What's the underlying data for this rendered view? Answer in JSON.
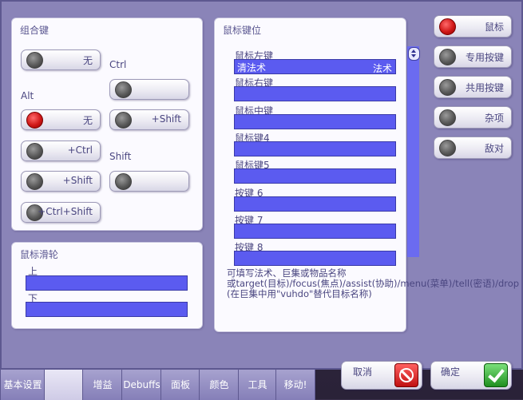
{
  "modifiers": {
    "title": "组合键",
    "ctrl_label": "Ctrl",
    "alt_label": "Alt",
    "shift_label": "Shift",
    "btn_none_top": "无",
    "btn_ctrl_blank": "",
    "btn_alt_none": "无",
    "btn_alt_shift": "+Shift",
    "btn_plus_ctrl": "+Ctrl",
    "btn_plus_shift": "+Shift",
    "btn_shift_blank": "",
    "btn_ctrl_shift": "+Ctrl+Shift"
  },
  "wheel": {
    "title": "鼠标滑轮",
    "up_label": "上",
    "down_label": "下",
    "up_value": "",
    "down_value": ""
  },
  "bindings": {
    "title": "鼠标键位",
    "items": [
      {
        "label": "鼠标左键",
        "value": "清法术",
        "type": "法术"
      },
      {
        "label": "鼠标右键",
        "value": "",
        "type": ""
      },
      {
        "label": "鼠标中键",
        "value": "",
        "type": ""
      },
      {
        "label": "鼠标键4",
        "value": "",
        "type": ""
      },
      {
        "label": "鼠标键5",
        "value": "",
        "type": ""
      },
      {
        "label": "按键 6",
        "value": "",
        "type": ""
      },
      {
        "label": "按键 7",
        "value": "",
        "type": ""
      },
      {
        "label": "按键 8",
        "value": "",
        "type": ""
      }
    ],
    "help_line1": "可填写法术、巨集或物品名称",
    "help_line2": "或target(目标)/focus(焦点)/assist(协助)/menu(菜单)/tell(密语)/drop",
    "help_line3": "(在巨集中用\"vuhdo\"替代目标名称)"
  },
  "categories": {
    "mouse": "鼠标",
    "special": "专用按键",
    "shared": "共用按键",
    "misc": "杂项",
    "hostile": "敌对"
  },
  "actions": {
    "cancel": "取消",
    "ok": "确定"
  },
  "tabs": [
    "基本设置",
    "",
    "增益",
    "Debuffs",
    "面板",
    "颜色",
    "工具",
    "移动!"
  ],
  "colors": {
    "frame": "#8a84b8",
    "field": "#5b5bf0",
    "accent_red": "#d01818",
    "accent_green": "#2aa02a"
  }
}
